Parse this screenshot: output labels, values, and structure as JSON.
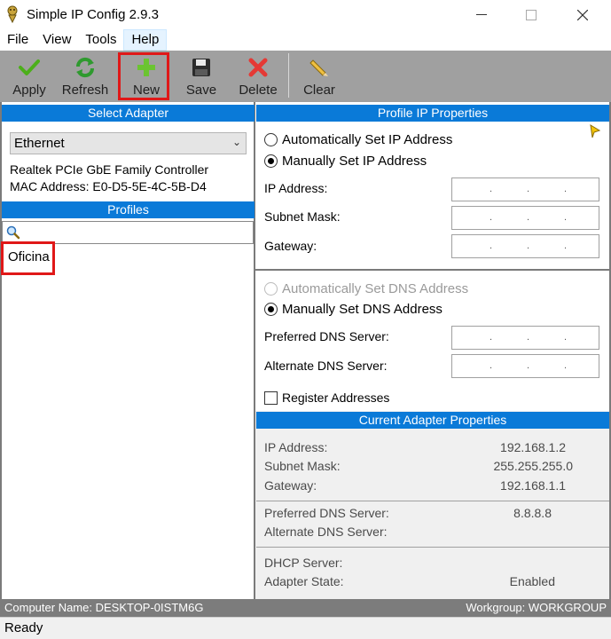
{
  "window": {
    "title": "Simple IP Config 2.9.3"
  },
  "menu": [
    "File",
    "View",
    "Tools",
    "Help"
  ],
  "toolbar": {
    "apply": "Apply",
    "refresh": "Refresh",
    "new": "New",
    "save": "Save",
    "delete": "Delete",
    "clear": "Clear"
  },
  "left": {
    "select_adapter_header": "Select Adapter",
    "adapter_value": "Ethernet",
    "adapter_description": "Realtek PCIe GbE Family Controller",
    "mac_address": "MAC Address: E0-D5-5E-4C-5B-D4",
    "profiles_header": "Profiles",
    "search_value": "",
    "profiles": [
      "Oficina"
    ]
  },
  "profile_ip": {
    "header": "Profile IP Properties",
    "auto_ip": "Automatically Set IP Address",
    "manual_ip": "Manually Set IP Address",
    "ip_label": "IP Address:",
    "subnet_label": "Subnet Mask:",
    "gateway_label": "Gateway:",
    "auto_dns": "Automatically Set DNS Address",
    "manual_dns": "Manually Set DNS Address",
    "pref_dns_label": "Preferred DNS Server:",
    "alt_dns_label": "Alternate DNS Server:",
    "register": "Register Addresses"
  },
  "current": {
    "header": "Current Adapter Properties",
    "ip_label": "IP Address:",
    "ip_value": "192.168.1.2",
    "subnet_label": "Subnet Mask:",
    "subnet_value": "255.255.255.0",
    "gateway_label": "Gateway:",
    "gateway_value": "192.168.1.1",
    "pref_dns_label": "Preferred DNS Server:",
    "pref_dns_value": "8.8.8.8",
    "alt_dns_label": "Alternate DNS Server:",
    "alt_dns_value": "",
    "dhcp_label": "DHCP Server:",
    "dhcp_value": "",
    "state_label": "Adapter State:",
    "state_value": "Enabled"
  },
  "info": {
    "computer_name": "Computer Name: DESKTOP-0ISTM6G",
    "workgroup": "Workgroup: WORKGROUP"
  },
  "status": {
    "text": "Ready"
  },
  "colors": {
    "accent": "#0a7ad8",
    "toolbar": "#a0a0a0",
    "highlight": "#e01818"
  }
}
